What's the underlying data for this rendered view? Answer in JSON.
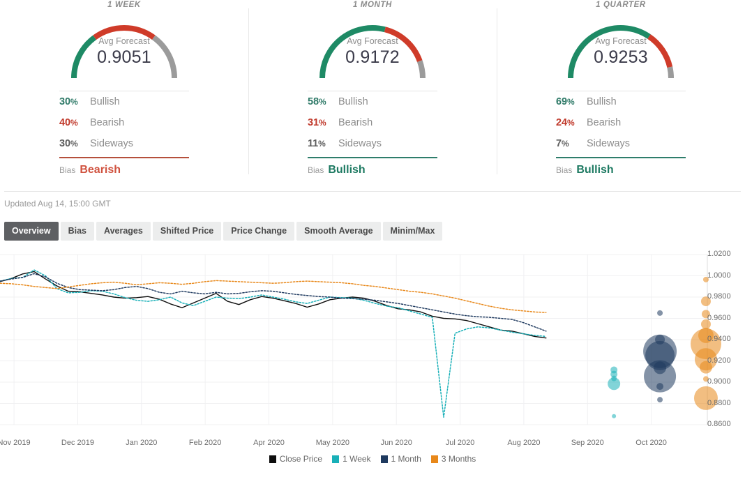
{
  "panels": [
    {
      "title": "1 WEEK",
      "gauge_label": "Avg Forecast",
      "value": "0.9051",
      "bullish_pct": "30",
      "bullish_label": "Bullish",
      "bearish_pct": "40",
      "bearish_label": "Bearish",
      "sideways_pct": "30",
      "sideways_label": "Sideways",
      "bias_label": "Bias",
      "bias_value": "Bearish",
      "bias_kind": "bearish",
      "bull": 30,
      "bear": 40,
      "side": 30
    },
    {
      "title": "1 MONTH",
      "gauge_label": "Avg Forecast",
      "value": "0.9172",
      "bullish_pct": "58",
      "bullish_label": "Bullish",
      "bearish_pct": "31",
      "bearish_label": "Bearish",
      "sideways_pct": "11",
      "sideways_label": "Sideways",
      "bias_label": "Bias",
      "bias_value": "Bullish",
      "bias_kind": "bullish",
      "bull": 58,
      "bear": 31,
      "side": 11
    },
    {
      "title": "1 QUARTER",
      "gauge_label": "Avg Forecast",
      "value": "0.9253",
      "bullish_pct": "69",
      "bullish_label": "Bullish",
      "bearish_pct": "24",
      "bearish_label": "Bearish",
      "sideways_pct": "7",
      "sideways_label": "Sideways",
      "bias_label": "Bias",
      "bias_value": "Bullish",
      "bias_kind": "bullish",
      "bull": 69,
      "bear": 24,
      "side": 7
    }
  ],
  "percent_symbol": "%",
  "updated": "Updated Aug 14, 15:00 GMT",
  "tabs": [
    {
      "label": "Overview",
      "active": true
    },
    {
      "label": "Bias",
      "active": false
    },
    {
      "label": "Averages",
      "active": false
    },
    {
      "label": "Shifted Price",
      "active": false
    },
    {
      "label": "Price Change",
      "active": false
    },
    {
      "label": "Smooth Average",
      "active": false
    },
    {
      "label": "Minim/Max",
      "active": false
    }
  ],
  "colors": {
    "bullish": "#1e8a65",
    "bearish": "#cf3b29",
    "sideways": "#9b9b9b",
    "bias_bullish": "#2e7d6b",
    "bias_bearish": "#b5503c",
    "close_price": "#0d0d0d",
    "one_week": "#19b0b8",
    "one_month": "#1f3a5f",
    "three_months": "#e8881a",
    "grid": "#f0f0f2",
    "tab_active_bg": "#5e6063",
    "tab_bg": "#eceded"
  },
  "chart_data": {
    "type": "line",
    "title": "",
    "xlabel": "",
    "ylabel": "",
    "ylim": [
      0.86,
      1.02
    ],
    "y_ticks": [
      "1.0200",
      "1.0000",
      "0.9800",
      "0.9600",
      "0.9400",
      "0.9200",
      "0.9000",
      "0.8800",
      "0.8600"
    ],
    "x_ticks": [
      "Nov 2019",
      "Dec 2019",
      "Jan 2020",
      "Feb 2020",
      "Apr 2020",
      "May 2020",
      "Jun 2020",
      "Jul 2020",
      "Aug 2020",
      "Sep 2020",
      "Oct 2020"
    ],
    "grid": true,
    "legend_position": "bottom",
    "legend": [
      "Close Price",
      "1 Week",
      "1 Month",
      "3 Months"
    ],
    "series": [
      {
        "name": "Close Price",
        "color": "#0d0d0d",
        "style": "solid",
        "values": [
          0.9945,
          0.9975,
          1.0018,
          1.004,
          0.997,
          0.9905,
          0.9855,
          0.985,
          0.9835,
          0.982,
          0.98,
          0.979,
          0.9795,
          0.9805,
          0.978,
          0.9735,
          0.97,
          0.9745,
          0.979,
          0.9835,
          0.976,
          0.973,
          0.9775,
          0.9805,
          0.979,
          0.9765,
          0.974,
          0.9705,
          0.9735,
          0.9775,
          0.979,
          0.98,
          0.979,
          0.976,
          0.972,
          0.969,
          0.968,
          0.966,
          0.962,
          0.96,
          0.9595,
          0.958,
          0.955,
          0.952,
          0.949,
          0.948,
          0.9455,
          0.943,
          0.9415
        ]
      },
      {
        "name": "1 Week",
        "color": "#19b0b8",
        "style": "dotted",
        "values": [
          0.995,
          0.9975,
          0.9985,
          1.0055,
          1.0,
          0.988,
          0.984,
          0.9845,
          0.986,
          0.9855,
          0.983,
          0.9795,
          0.977,
          0.976,
          0.9775,
          0.98,
          0.9745,
          0.972,
          0.976,
          0.98,
          0.979,
          0.9785,
          0.98,
          0.982,
          0.98,
          0.978,
          0.9755,
          0.974,
          0.977,
          0.98,
          0.9795,
          0.979,
          0.977,
          0.974,
          0.9715,
          0.97,
          0.967,
          0.964,
          0.961,
          0.867,
          0.946,
          0.95,
          0.952,
          0.951,
          0.949,
          0.947,
          0.9455,
          0.944,
          0.943
        ]
      },
      {
        "name": "1 Month",
        "color": "#1f3a5f",
        "style": "dotted",
        "values": [
          0.995,
          0.997,
          0.9985,
          1.002,
          0.999,
          0.993,
          0.989,
          0.987,
          0.9865,
          0.986,
          0.987,
          0.989,
          0.99,
          0.988,
          0.9845,
          0.983,
          0.9855,
          0.984,
          0.983,
          0.9845,
          0.983,
          0.9835,
          0.985,
          0.986,
          0.9855,
          0.984,
          0.9825,
          0.9815,
          0.9805,
          0.98,
          0.979,
          0.9785,
          0.978,
          0.977,
          0.9755,
          0.974,
          0.972,
          0.97,
          0.968,
          0.966,
          0.964,
          0.9625,
          0.9615,
          0.961,
          0.96,
          0.959,
          0.956,
          0.952,
          0.948
        ]
      },
      {
        "name": "3 Months",
        "color": "#e8881a",
        "style": "dotted",
        "values": [
          0.993,
          0.9925,
          0.9915,
          0.99,
          0.989,
          0.988,
          0.9895,
          0.991,
          0.9925,
          0.9935,
          0.994,
          0.993,
          0.9915,
          0.9925,
          0.9935,
          0.993,
          0.992,
          0.993,
          0.9945,
          0.9955,
          0.995,
          0.9945,
          0.994,
          0.9935,
          0.993,
          0.9935,
          0.9945,
          0.995,
          0.9945,
          0.994,
          0.9935,
          0.9925,
          0.991,
          0.99,
          0.9885,
          0.987,
          0.9855,
          0.9845,
          0.983,
          0.981,
          0.979,
          0.9765,
          0.974,
          0.9715,
          0.9695,
          0.968,
          0.967,
          0.966,
          0.9655
        ]
      }
    ],
    "bubbles": [
      {
        "series": "1 Week",
        "color": "#19b0b8",
        "x": 0.868,
        "y": 0.9115,
        "r": 5
      },
      {
        "series": "1 Week",
        "color": "#19b0b8",
        "x": 0.868,
        "y": 0.9075,
        "r": 5
      },
      {
        "series": "1 Week",
        "color": "#19b0b8",
        "x": 0.868,
        "y": 0.9035,
        "r": 4
      },
      {
        "series": "1 Week",
        "color": "#19b0b8",
        "x": 0.868,
        "y": 0.8985,
        "r": 9
      },
      {
        "series": "1 Week",
        "color": "#19b0b8",
        "x": 0.868,
        "y": 0.868,
        "r": 3
      },
      {
        "series": "1 Month",
        "color": "#1f3a5f",
        "x": 0.933,
        "y": 0.965,
        "r": 4
      },
      {
        "series": "1 Month",
        "color": "#1f3a5f",
        "x": 0.933,
        "y": 0.94,
        "r": 7
      },
      {
        "series": "1 Month",
        "color": "#1f3a5f",
        "x": 0.933,
        "y": 0.929,
        "r": 24
      },
      {
        "series": "1 Month",
        "color": "#1f3a5f",
        "x": 0.933,
        "y": 0.925,
        "r": 21
      },
      {
        "series": "1 Month",
        "color": "#1f3a5f",
        "x": 0.933,
        "y": 0.9135,
        "r": 9
      },
      {
        "series": "1 Month",
        "color": "#1f3a5f",
        "x": 0.933,
        "y": 0.9055,
        "r": 23
      },
      {
        "series": "1 Month",
        "color": "#1f3a5f",
        "x": 0.933,
        "y": 0.896,
        "r": 5
      },
      {
        "series": "1 Month",
        "color": "#1f3a5f",
        "x": 0.933,
        "y": 0.8835,
        "r": 4
      },
      {
        "series": "3 Months",
        "color": "#e8881a",
        "x": 0.998,
        "y": 0.9965,
        "r": 4
      },
      {
        "series": "3 Months",
        "color": "#e8881a",
        "x": 0.998,
        "y": 0.976,
        "r": 7
      },
      {
        "series": "3 Months",
        "color": "#e8881a",
        "x": 0.998,
        "y": 0.964,
        "r": 6
      },
      {
        "series": "3 Months",
        "color": "#e8881a",
        "x": 0.998,
        "y": 0.9545,
        "r": 7
      },
      {
        "series": "3 Months",
        "color": "#e8881a",
        "x": 0.998,
        "y": 0.944,
        "r": 11
      },
      {
        "series": "3 Months",
        "color": "#e8881a",
        "x": 0.998,
        "y": 0.936,
        "r": 22
      },
      {
        "series": "3 Months",
        "color": "#e8881a",
        "x": 0.998,
        "y": 0.9215,
        "r": 16
      },
      {
        "series": "3 Months",
        "color": "#e8881a",
        "x": 0.998,
        "y": 0.914,
        "r": 9
      },
      {
        "series": "3 Months",
        "color": "#e8881a",
        "x": 0.998,
        "y": 0.903,
        "r": 4
      },
      {
        "series": "3 Months",
        "color": "#e8881a",
        "x": 0.998,
        "y": 0.885,
        "r": 17
      }
    ]
  }
}
